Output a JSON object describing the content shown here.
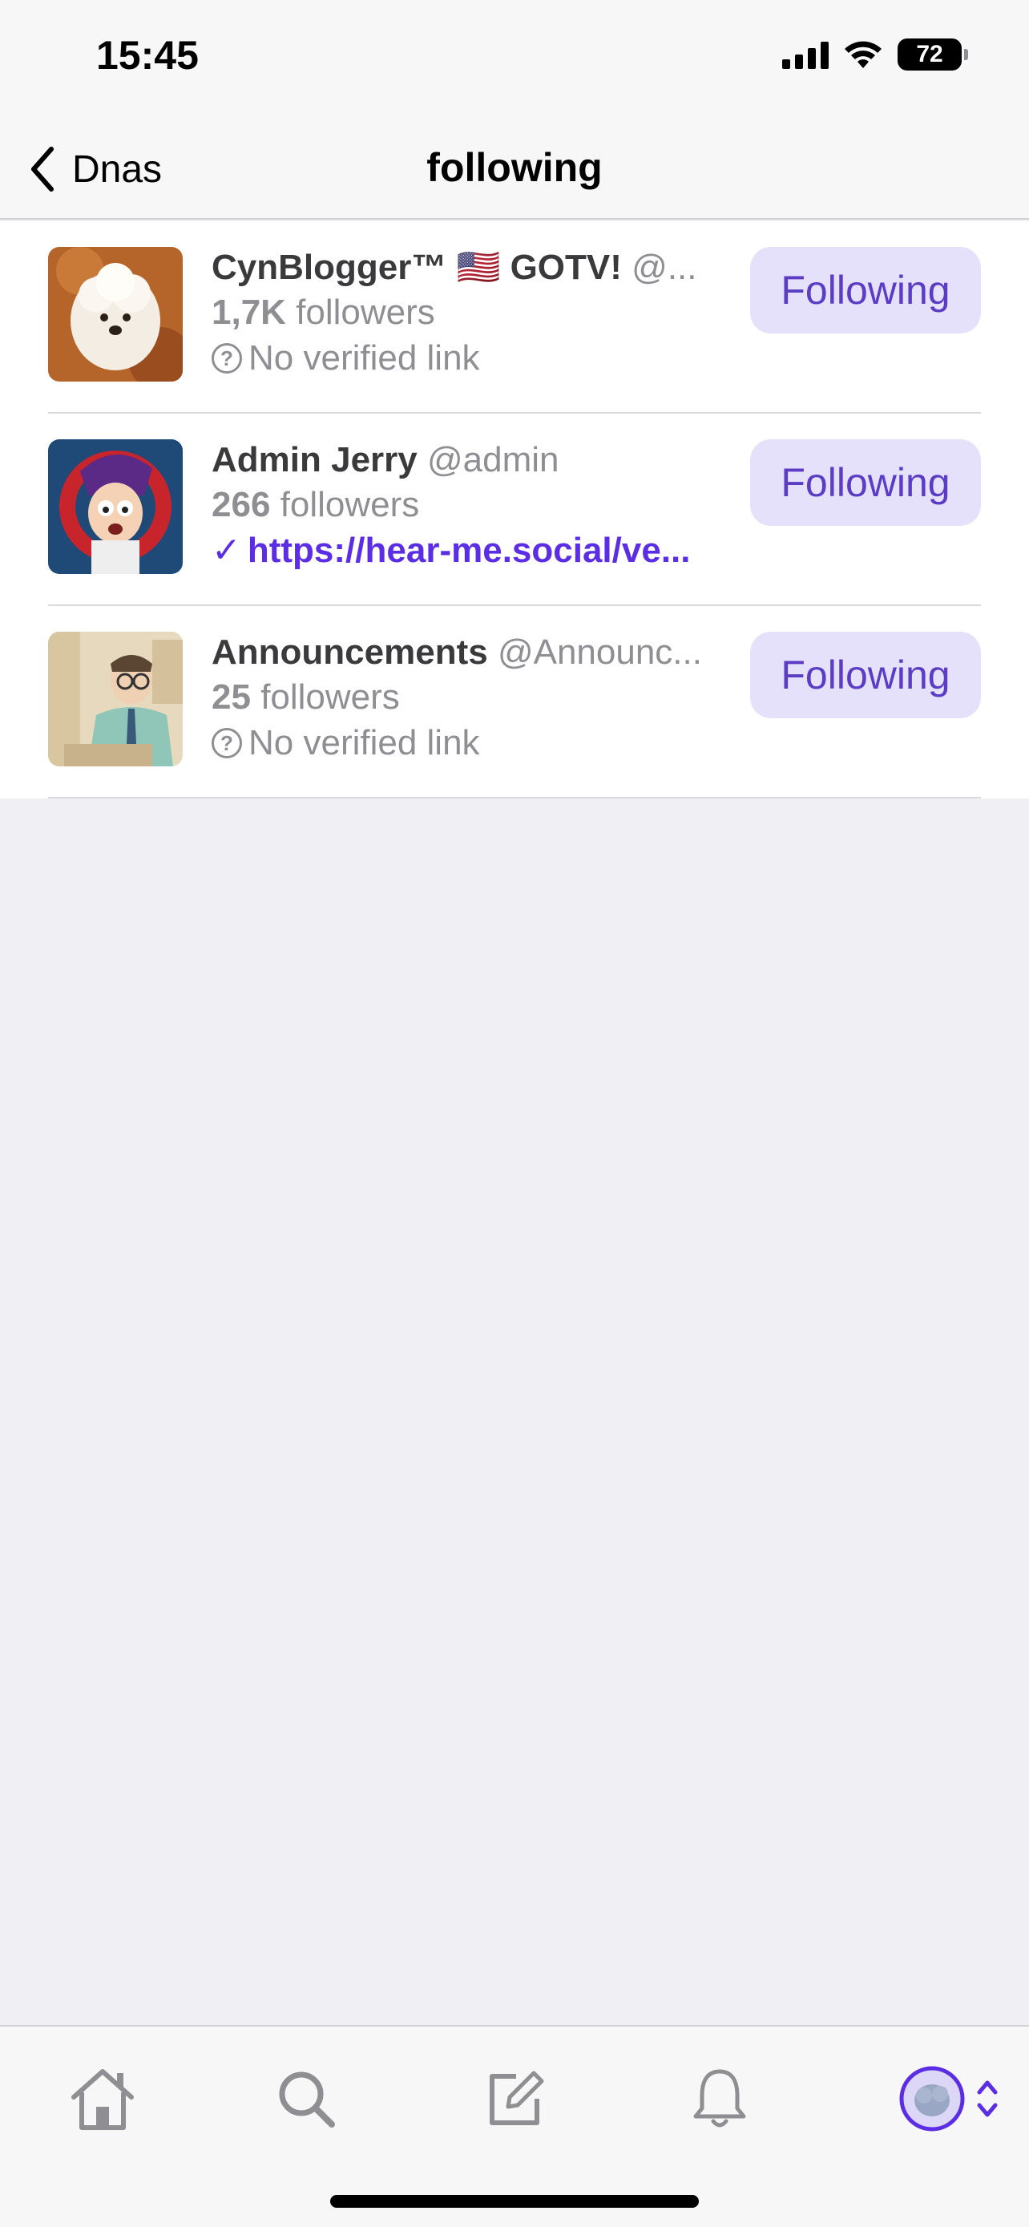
{
  "status_bar": {
    "time": "15:45",
    "battery": "72",
    "icons": [
      "cellular-signal-icon",
      "wifi-icon",
      "battery-icon"
    ]
  },
  "nav": {
    "back_label": "Dnas",
    "title": "following"
  },
  "accounts": [
    {
      "display_name": "CynBlogger™ 🇺🇸 GOTV!",
      "handle": "@...",
      "follower_count": "1,7K",
      "followers_label": "followers",
      "link_text": "No verified link",
      "verified": false,
      "button_label": "Following"
    },
    {
      "display_name": "Admin Jerry",
      "handle": "@admin",
      "follower_count": "266",
      "followers_label": "followers",
      "link_text": "https://hear-me.social/ve...",
      "verified": true,
      "button_label": "Following"
    },
    {
      "display_name": "Announcements",
      "handle": "@Announc...",
      "follower_count": "25",
      "followers_label": "followers",
      "link_text": "No verified link",
      "verified": false,
      "button_label": "Following"
    }
  ],
  "tab_bar": {
    "tabs": [
      "home-icon",
      "search-icon",
      "compose-icon",
      "bell-icon",
      "profile-avatar"
    ],
    "accent": "#5b2ee6"
  },
  "colors": {
    "accent": "#5b2ee6",
    "button_bg": "#e6e1fb",
    "secondary_text": "#8e8e93"
  }
}
